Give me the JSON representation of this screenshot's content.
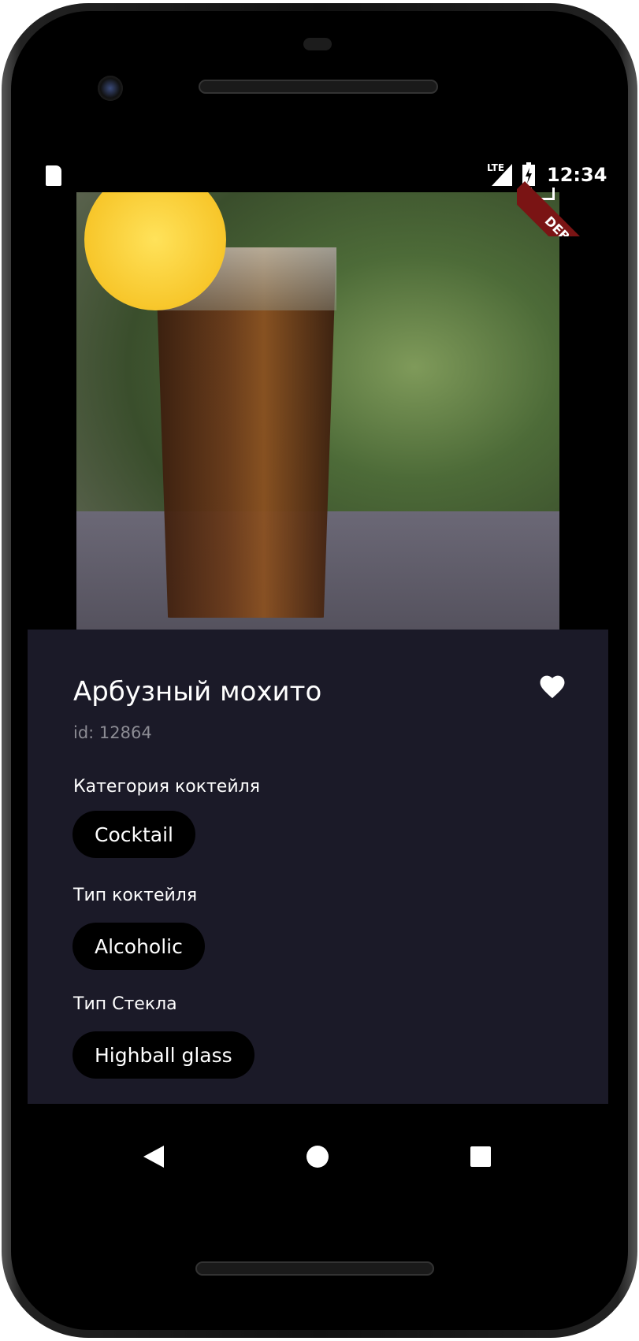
{
  "status_bar": {
    "time": "12:34",
    "network": "LTE"
  },
  "debug_banner": "DEBUG",
  "cocktail": {
    "name": "Арбузный мохито",
    "id_text": "id: 12864",
    "sections": [
      {
        "label": "Категория коктейля",
        "value": "Cocktail"
      },
      {
        "label": "Тип коктейля",
        "value": "Alcoholic"
      },
      {
        "label": "Тип Стекла",
        "value": "Highball glass"
      }
    ]
  }
}
